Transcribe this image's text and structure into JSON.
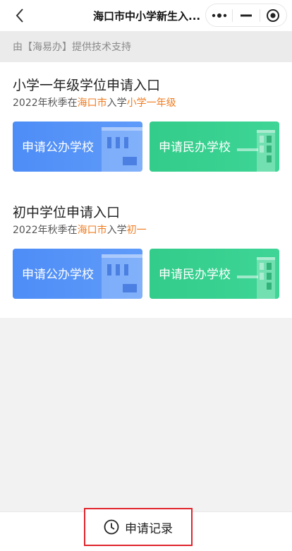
{
  "navbar": {
    "title": "海口市中小学新生入..."
  },
  "support": {
    "text": "由【海易办】提供技术支持"
  },
  "primary": {
    "title": "小学一年级学位申请入口",
    "sub_prefix": "2022年秋季在",
    "sub_city": "海口市",
    "sub_mid": "入学",
    "sub_grade": "小学一年级",
    "public_label": "申请公办学校",
    "private_label": "申请民办学校"
  },
  "middle": {
    "title": "初中学位申请入口",
    "sub_prefix": "2022年秋季在",
    "sub_city": "海口市",
    "sub_mid": "入学",
    "sub_grade": "初一",
    "public_label": "申请公办学校",
    "private_label": "申请民办学校"
  },
  "bottom": {
    "record_label": "申请记录"
  },
  "icons": {
    "back": "chevron-left-icon",
    "more": "more-dots-icon",
    "minimize": "minimize-icon",
    "close": "target-close-icon",
    "clock": "clock-icon"
  },
  "colors": {
    "highlight": "#f07b1f",
    "public_button": "#4e8df7",
    "private_button": "#33cc8a",
    "record_border": "#e0242b"
  }
}
